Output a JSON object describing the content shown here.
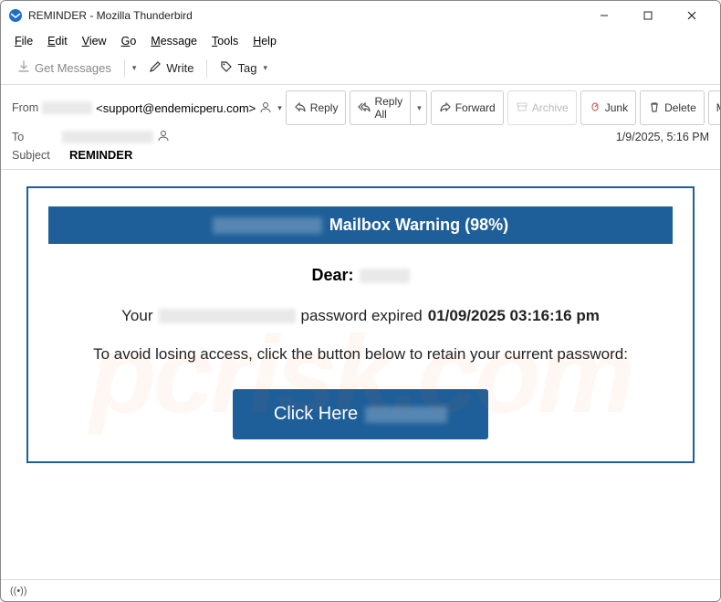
{
  "window": {
    "title": "REMINDER - Mozilla Thunderbird"
  },
  "menubar": {
    "file": "File",
    "edit": "Edit",
    "view": "View",
    "go": "Go",
    "message": "Message",
    "tools": "Tools",
    "help": "Help"
  },
  "toolbar": {
    "get_messages": "Get Messages",
    "write": "Write",
    "tag": "Tag"
  },
  "header": {
    "from_label": "From",
    "from_email": "<support@endemicperu.com>",
    "to_label": "To",
    "subject_label": "Subject",
    "subject_value": "REMINDER",
    "date": "1/9/2025, 5:16 PM"
  },
  "actions": {
    "reply": "Reply",
    "reply_all": "Reply All",
    "forward": "Forward",
    "archive": "Archive",
    "junk": "Junk",
    "delete": "Delete",
    "more": "More"
  },
  "email": {
    "banner_text": "Mailbox Warning (98%)",
    "dear": "Dear:",
    "line1_pre": "Your",
    "line1_post": "password expired",
    "expired_date": "01/09/2025 03:16:16 pm",
    "line2": "To avoid losing access, click the button below to retain your current password:",
    "cta": "Click Here"
  },
  "status": {
    "signal": "((•))"
  },
  "watermark": "pcrisk.com"
}
